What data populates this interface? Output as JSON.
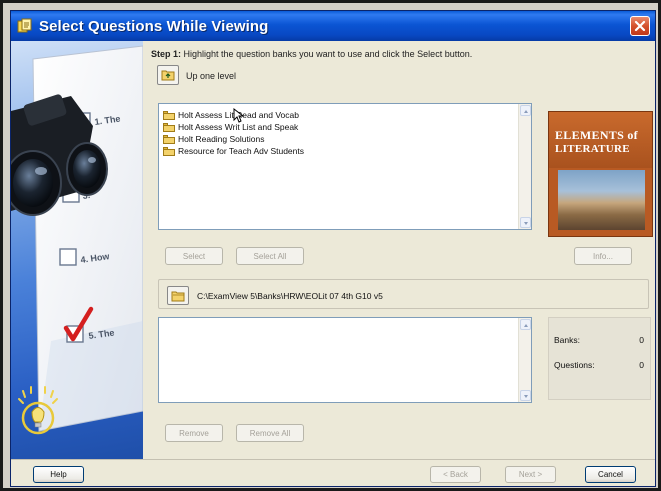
{
  "window": {
    "title": "Select Questions While Viewing"
  },
  "step": {
    "label": "Step 1:",
    "instruction": "Highlight the question banks you want to use and click the Select button."
  },
  "nav": {
    "up_label": "Up one level"
  },
  "question_banks": [
    "Holt Assess Lit Read and Vocab",
    "Holt Assess Writ List and Speak",
    "Holt Reading Solutions",
    "Resource for Teach Adv Students"
  ],
  "buttons": {
    "select": "Select",
    "select_all": "Select All",
    "info": "Info...",
    "remove": "Remove",
    "remove_all": "Remove All",
    "help": "Help",
    "back": "< Back",
    "next": "Next >",
    "cancel": "Cancel"
  },
  "book_cover": {
    "line1": "ELEMENTS of",
    "line2": "LITERATURE"
  },
  "sidebar_items": [
    "1. The",
    "3.",
    "4. How",
    "5. The"
  ],
  "path": {
    "text": "C:\\ExamView 5\\Banks\\HRW\\EOLit 07 4th G10 v5"
  },
  "counts": {
    "banks_label": "Banks:",
    "banks_value": "0",
    "questions_label": "Questions:",
    "questions_value": "0"
  },
  "colors": {
    "title_bar": "#0b55d4",
    "close_button": "#d4512c",
    "window_bg": "#ece9d8"
  }
}
